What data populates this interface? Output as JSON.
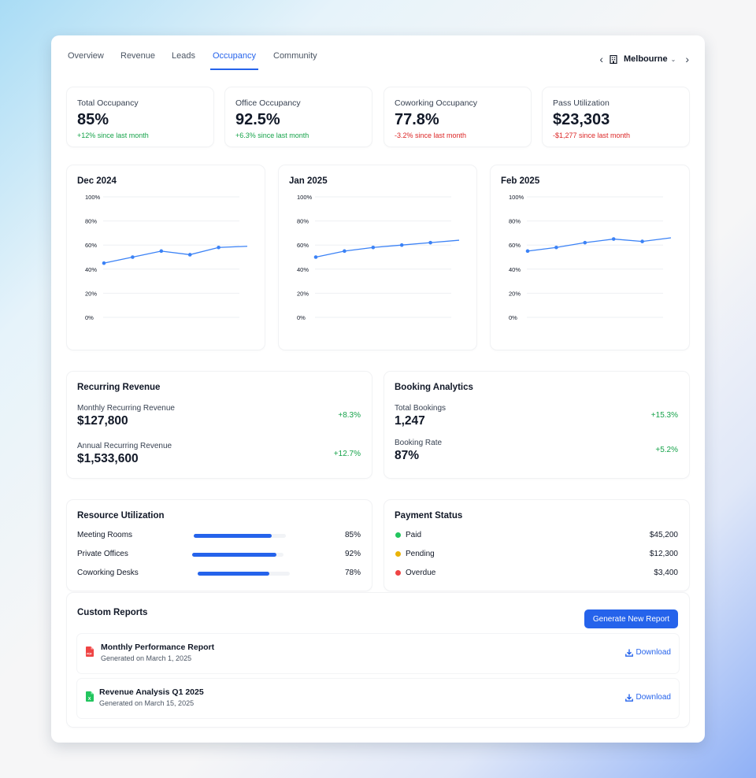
{
  "nav": {
    "tabs": [
      "Overview",
      "Revenue",
      "Leads",
      "Occupancy",
      "Community"
    ],
    "active": "Occupancy",
    "location": "Melbourne"
  },
  "stats": [
    {
      "label": "Total Occupancy",
      "value": "85%",
      "change": "+12% since last month",
      "trend": "up"
    },
    {
      "label": "Office Occupancy",
      "value": "92.5%",
      "change": "+6.3% since last month",
      "trend": "up"
    },
    {
      "label": "Coworking Occupancy",
      "value": "77.8%",
      "change": "-3.2% since last month",
      "trend": "down"
    },
    {
      "label": "Pass Utilization",
      "value": "$23,303",
      "change": "-$1,277 since last month",
      "trend": "down"
    }
  ],
  "chart_data": [
    {
      "type": "line",
      "title": "Dec 2024",
      "x": [
        1,
        2,
        3,
        4,
        5,
        6
      ],
      "values": [
        45,
        50,
        55,
        52,
        58,
        59
      ],
      "ylim": [
        0,
        100
      ],
      "yticks": [
        "100%",
        "80%",
        "60%",
        "40%",
        "20%",
        "0%"
      ],
      "color": "#3b82f6",
      "grid": true
    },
    {
      "type": "line",
      "title": "Jan 2025",
      "x": [
        1,
        2,
        3,
        4,
        5,
        6
      ],
      "values": [
        50,
        55,
        58,
        60,
        62,
        64
      ],
      "ylim": [
        0,
        100
      ],
      "yticks": [
        "100%",
        "80%",
        "60%",
        "40%",
        "20%",
        "0%"
      ],
      "color": "#3b82f6",
      "grid": true
    },
    {
      "type": "line",
      "title": "Feb 2025",
      "x": [
        1,
        2,
        3,
        4,
        5,
        6
      ],
      "values": [
        55,
        58,
        62,
        65,
        63,
        66
      ],
      "ylim": [
        0,
        100
      ],
      "yticks": [
        "100%",
        "80%",
        "60%",
        "40%",
        "20%",
        "0%"
      ],
      "color": "#3b82f6",
      "grid": true
    }
  ],
  "recurring": {
    "title": "Recurring Revenue",
    "items": [
      {
        "label": "Monthly Recurring Revenue",
        "value": "$127,800",
        "change": "+8.3%"
      },
      {
        "label": "Annual Recurring Revenue",
        "value": "$1,533,600",
        "change": "+12.7%"
      }
    ]
  },
  "booking": {
    "title": "Booking Analytics",
    "items": [
      {
        "label": "Total Bookings",
        "value": "1,247",
        "change": "+15.3%"
      },
      {
        "label": "Booking Rate",
        "value": "87%",
        "change": "+5.2%"
      }
    ]
  },
  "resources": {
    "title": "Resource Utilization",
    "items": [
      {
        "label": "Meeting Rooms",
        "pct": "85%",
        "value": 85
      },
      {
        "label": "Private Offices",
        "pct": "92%",
        "value": 92
      },
      {
        "label": "Coworking Desks",
        "pct": "78%",
        "value": 78
      }
    ]
  },
  "payments": {
    "title": "Payment Status",
    "items": [
      {
        "label": "Paid",
        "amount": "$45,200",
        "color": "#22c55e"
      },
      {
        "label": "Pending",
        "amount": "$12,300",
        "color": "#eab308"
      },
      {
        "label": "Overdue",
        "amount": "$3,400",
        "color": "#ef4444"
      }
    ]
  },
  "reports": {
    "title": "Custom Reports",
    "button": "Generate New Report",
    "download_label": "Download",
    "items": [
      {
        "title": "Monthly Performance Report",
        "sub": "Generated on March 1, 2025",
        "icon": "pdf-file-icon",
        "color": "#ef4444"
      },
      {
        "title": "Revenue Analysis Q1 2025",
        "sub": "Generated on March 15, 2025",
        "icon": "excel-file-icon",
        "color": "#22c55e"
      }
    ]
  }
}
